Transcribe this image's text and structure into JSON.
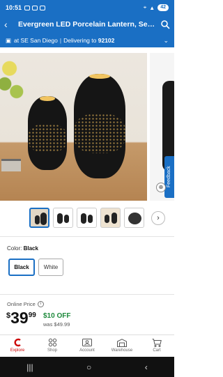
{
  "status_bar": {
    "time": "10:51",
    "battery": "42"
  },
  "header": {
    "title": "Evergreen LED Porcelain Lantern, Set of..."
  },
  "location": {
    "store": "at SE San Diego",
    "separator": "|",
    "delivering_label": "Delivering to",
    "zip": "92102"
  },
  "gallery": {
    "feedback_label": "Feedback"
  },
  "variant": {
    "label": "Color:",
    "selected": "Black",
    "options": [
      "Black",
      "White"
    ]
  },
  "price": {
    "label": "Online Price",
    "currency": "$",
    "dollars": "39",
    "cents": "99",
    "savings": "$10 OFF",
    "was": "was $49.99"
  },
  "bottom_nav": [
    {
      "label": "Explore",
      "icon": "explore-logo-icon"
    },
    {
      "label": "Shop",
      "icon": "grid-icon"
    },
    {
      "label": "Account",
      "icon": "account-card-icon"
    },
    {
      "label": "Warehouse",
      "icon": "warehouse-icon"
    },
    {
      "label": "Cart",
      "icon": "cart-icon"
    }
  ],
  "colors": {
    "brand": "#1a6fc4",
    "savings": "#1e8a3c",
    "explore": "#cc0000"
  }
}
